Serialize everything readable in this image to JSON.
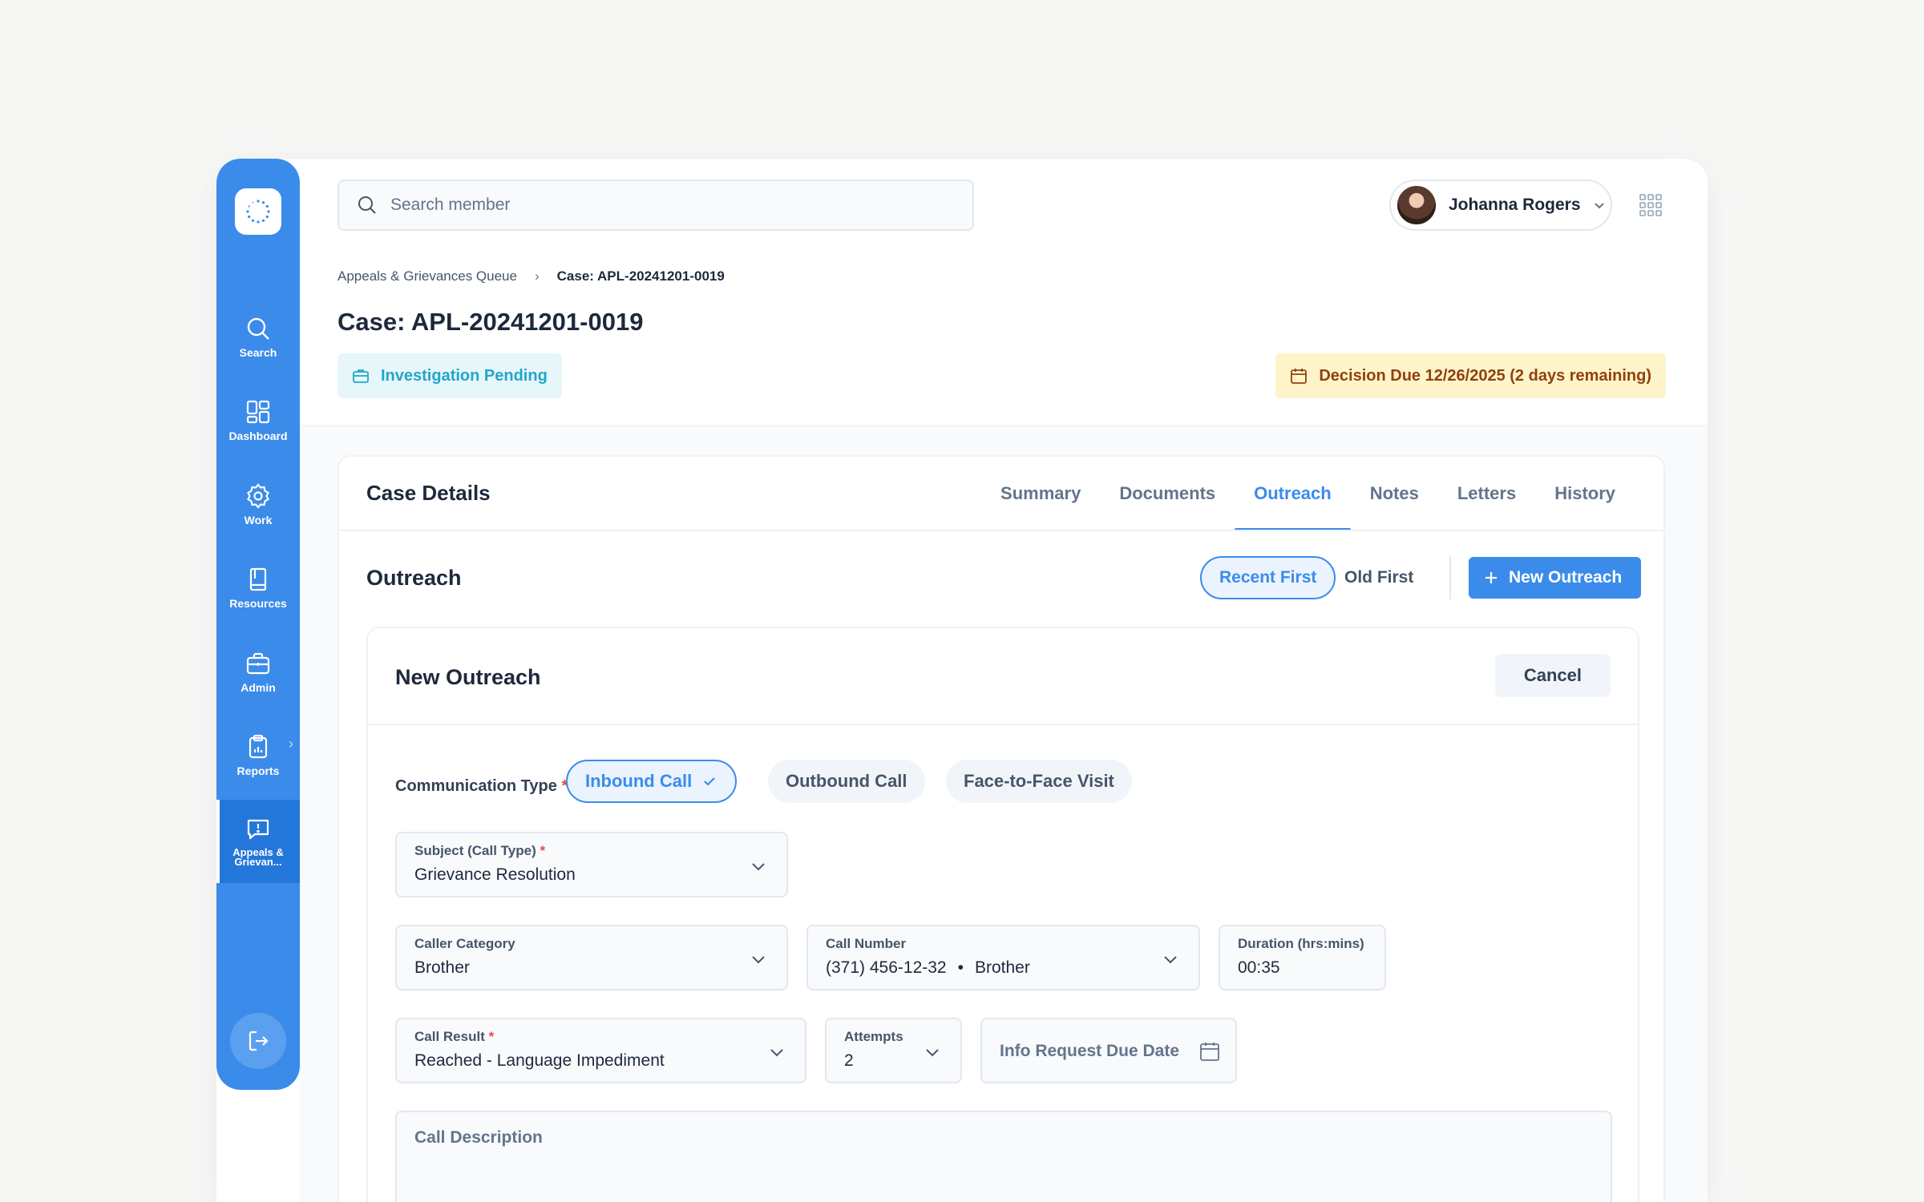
{
  "sidebar": {
    "items": [
      {
        "label": "Search",
        "icon": "search-icon"
      },
      {
        "label": "Dashboard",
        "icon": "dashboard-icon"
      },
      {
        "label": "Work",
        "icon": "gear-icon"
      },
      {
        "label": "Resources",
        "icon": "book-icon"
      },
      {
        "label": "Admin",
        "icon": "briefcase-icon"
      },
      {
        "label": "Reports",
        "icon": "clipboard-icon"
      },
      {
        "label": "Appeals & Grievan...",
        "icon": "alert-message-icon",
        "active": true
      }
    ]
  },
  "header": {
    "search_placeholder": "Search member",
    "user_name": "Johanna Rogers"
  },
  "breadcrumb": {
    "parent": "Appeals & Grievances Queue",
    "current": "Case: APL-20241201-0019"
  },
  "case": {
    "title": "Case: APL-20241201-0019",
    "status": "Investigation Pending",
    "decision_due": "Decision Due 12/26/2025 (2 days remaining)"
  },
  "card": {
    "title": "Case Details",
    "tabs": [
      "Summary",
      "Documents",
      "Outreach",
      "Notes",
      "Letters",
      "History"
    ],
    "active_tab": "Outreach"
  },
  "outreach": {
    "title": "Outreach",
    "sort_recent": "Recent First",
    "sort_old": "Old First",
    "new_button": "New Outreach"
  },
  "form": {
    "title": "New Outreach",
    "cancel": "Cancel",
    "communication_type_label": "Communication Type",
    "communication_types": [
      "Inbound Call",
      "Outbound Call",
      "Face-to-Face Visit"
    ],
    "selected_type": "Inbound Call",
    "subject_label": "Subject (Call Type)",
    "subject_value": "Grievance Resolution",
    "caller_category_label": "Caller Category",
    "caller_category_value": "Brother",
    "call_number_label": "Call Number",
    "call_number_value": "(371) 456-12-32",
    "call_number_relation": "Brother",
    "duration_label": "Duration (hrs:mins)",
    "duration_value": "00:35",
    "call_result_label": "Call Result",
    "call_result_value": "Reached - Language Impediment",
    "attempts_label": "Attempts",
    "attempts_value": "2",
    "info_due_placeholder": "Info Request Due Date",
    "description_label": "Call Description"
  },
  "colors": {
    "primary": "#3b8beb",
    "status_text": "#22a6c8",
    "due_bg": "#fdf5c9",
    "due_text": "#92400e",
    "required": "#ef4444"
  }
}
